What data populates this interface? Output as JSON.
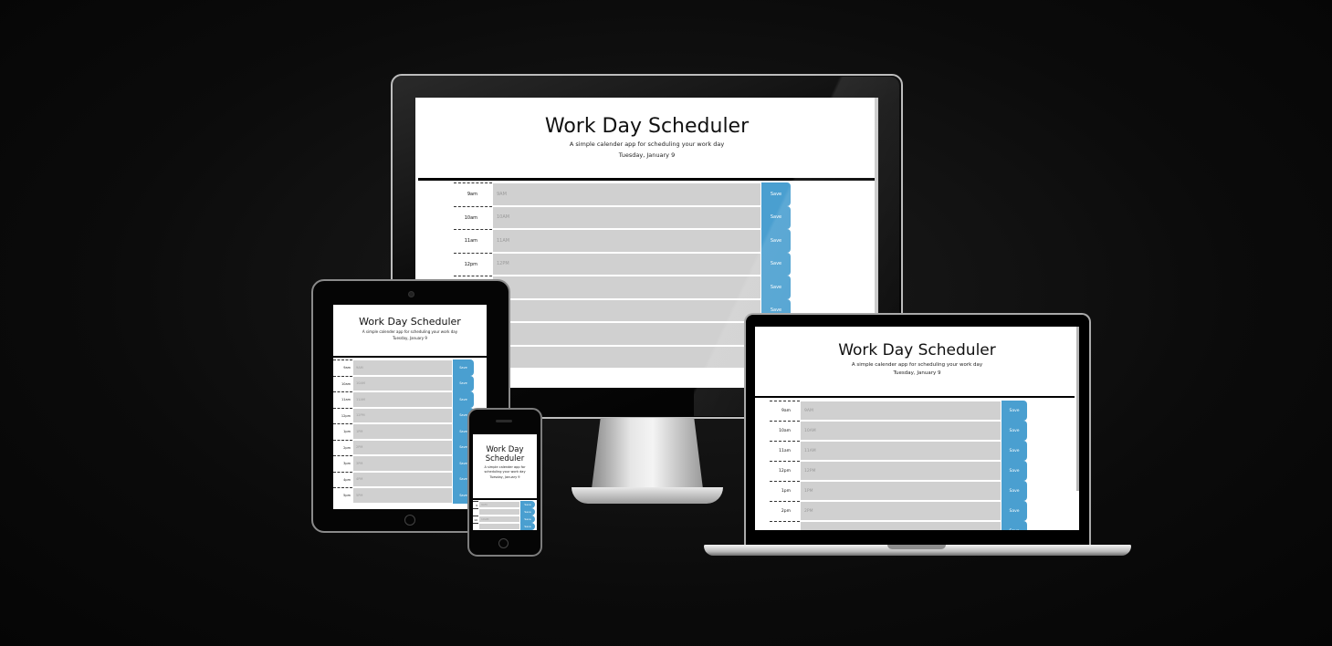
{
  "app": {
    "title": "Work Day Scheduler",
    "subtitle": "A simple calender app for scheduling your work day",
    "date": "Tuesday, January 9",
    "save_label": "Save"
  },
  "monitor": {
    "hours": [
      "9am",
      "10am",
      "11am",
      "12pm",
      "",
      "",
      "",
      ""
    ],
    "placeholders": [
      "9AM",
      "10AM",
      "11AM",
      "12PM",
      "",
      "",
      "",
      ""
    ]
  },
  "tablet": {
    "hours": [
      "9am",
      "10am",
      "11am",
      "12pm",
      "1pm",
      "2pm",
      "3pm",
      "4pm",
      "5pm"
    ],
    "placeholders": [
      "9AM",
      "10AM",
      "11AM",
      "12PM",
      "1PM",
      "2PM",
      "3PM",
      "4PM",
      "5PM"
    ]
  },
  "phone": {
    "title_line1": "Work Day",
    "title_line2": "Scheduler",
    "hours": [
      "9",
      "",
      "10",
      ""
    ],
    "placeholders": [
      "9AM",
      "",
      "10AM",
      ""
    ]
  },
  "laptop": {
    "hours": [
      "9am",
      "10am",
      "11am",
      "12pm",
      "1pm",
      "2pm",
      ""
    ],
    "placeholders": [
      "9AM",
      "10AM",
      "11AM",
      "12PM",
      "1PM",
      "2PM",
      ""
    ]
  },
  "colors": {
    "past": "#d0d0d0",
    "save_button": "#4a9fd0",
    "background": "#0b0b0b"
  }
}
